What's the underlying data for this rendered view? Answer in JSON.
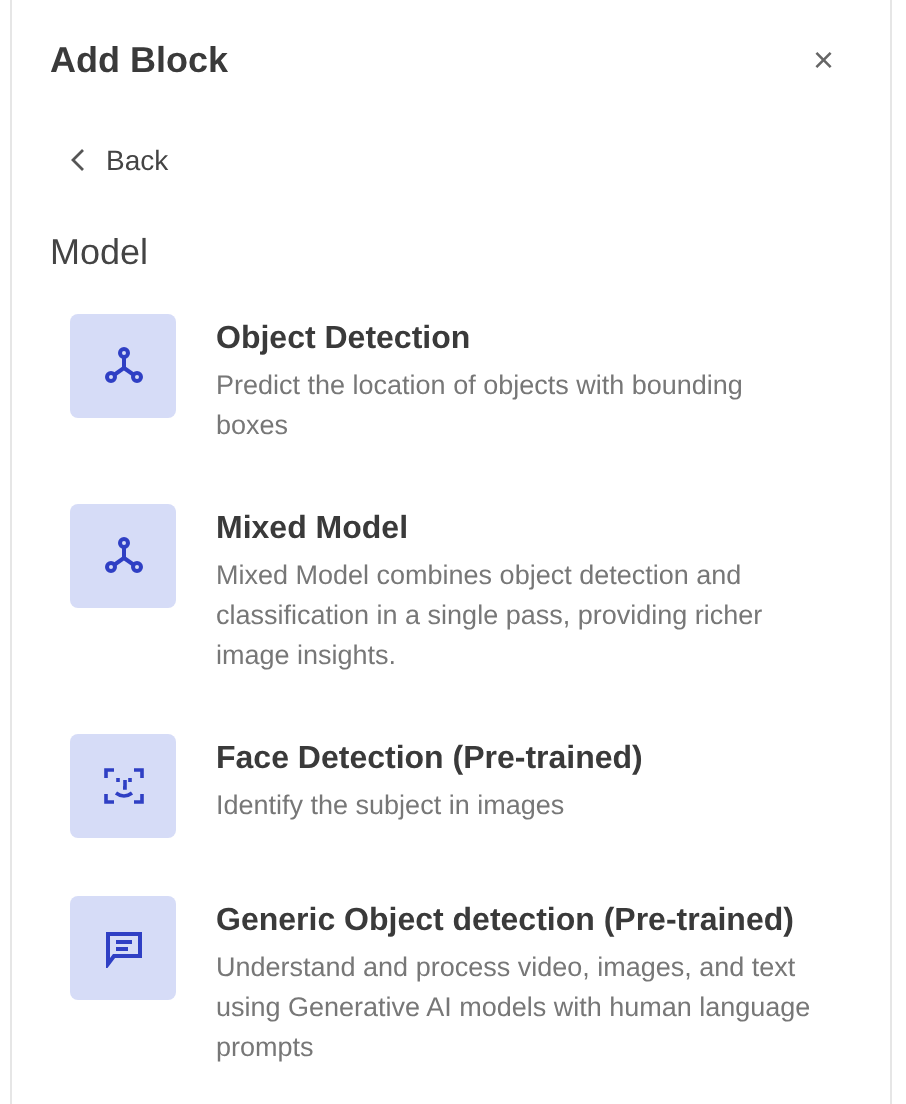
{
  "header": {
    "title": "Add Block",
    "close": "×"
  },
  "back": "Back",
  "section": "Model",
  "blocks": [
    {
      "kind": "graph",
      "title": "Object Detection",
      "description": "Predict the location of objects with bounding boxes"
    },
    {
      "kind": "graph",
      "title": "Mixed Model",
      "description": "Mixed Model combines object detection and classification in a single pass, providing richer image insights."
    },
    {
      "kind": "face",
      "title": "Face Detection (Pre-trained)",
      "description": "Identify the subject in images"
    },
    {
      "kind": "chat",
      "title": "Generic Object detection (Pre-trained)",
      "description": "Understand and process video, images, and text using Generative AI models with human language prompts"
    }
  ]
}
